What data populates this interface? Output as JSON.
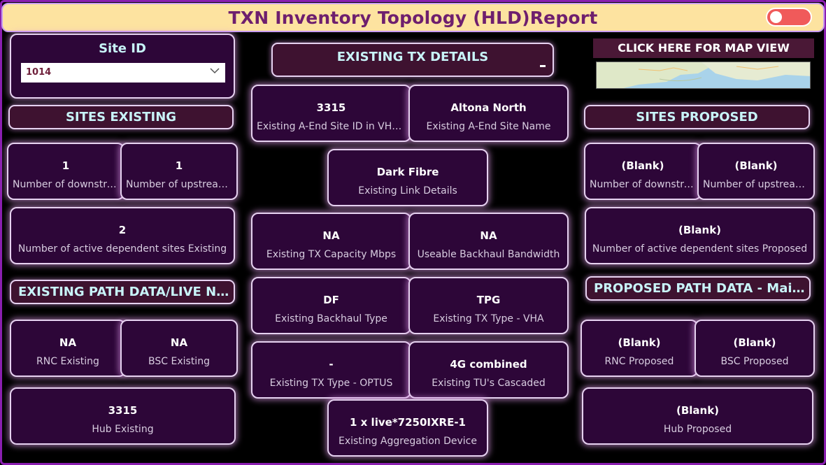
{
  "report": {
    "title": "TXN Inventory Topology (HLD)Report",
    "toggle_state": "off"
  },
  "slicer": {
    "label": "Site ID",
    "selected": "1014"
  },
  "headers": {
    "sites_existing": "SITES EXISTING",
    "existing_tx_details": "EXISTING TX DETAILS",
    "map_view_button": "CLICK HERE FOR MAP VIEW",
    "sites_proposed": "SITES PROPOSED",
    "existing_path": "EXISTING PATH DATA/LIVE NET...",
    "proposed_path": "PROPOSED PATH DATA - Main Ba..."
  },
  "left": {
    "downstream": {
      "value": "1",
      "label": "Number of downstre..."
    },
    "upstream": {
      "value": "1",
      "label": "Number of upstream..."
    },
    "active_dependent": {
      "value": "2",
      "label": "Number of active dependent sites Existing"
    },
    "rnc": {
      "value": "NA",
      "label": "RNC Existing"
    },
    "bsc": {
      "value": "NA",
      "label": "BSC Existing"
    },
    "hub": {
      "value": "3315",
      "label": "Hub Existing"
    }
  },
  "middle": {
    "a_end_site_id": {
      "value": "3315",
      "label": "Existing A-End Site ID in VHA ..."
    },
    "a_end_site_name": {
      "value": "Altona North",
      "label": "Existing A-End Site Name"
    },
    "link_details": {
      "value": "Dark Fibre",
      "label": "Existing Link Details"
    },
    "tx_capacity": {
      "value": "NA",
      "label": "Existing TX Capacity Mbps"
    },
    "backhaul_bandwidth": {
      "value": "NA",
      "label": "Useable Backhaul Bandwidth"
    },
    "backhaul_type": {
      "value": "DF",
      "label": "Existing Backhaul Type"
    },
    "tx_type_vha": {
      "value": "TPG",
      "label": "Existing TX Type - VHA"
    },
    "tx_type_optus": {
      "value": "-",
      "label": "Existing TX Type - OPTUS"
    },
    "tus_cascaded": {
      "value": "4G combined",
      "label": "Existing TU's Cascaded"
    },
    "aggregation_device": {
      "value": "1 x live*7250IXRE-1",
      "label": "Existing Aggregation Device"
    }
  },
  "right": {
    "downstream": {
      "value": "(Blank)",
      "label": "Number of downstre..."
    },
    "upstream": {
      "value": "(Blank)",
      "label": "Number of upstream..."
    },
    "active_dependent": {
      "value": "(Blank)",
      "label": "Number of active dependent sites Proposed"
    },
    "rnc": {
      "value": "(Blank)",
      "label": "RNC Proposed"
    },
    "bsc": {
      "value": "(Blank)",
      "label": "BSC Proposed"
    },
    "hub": {
      "value": "(Blank)",
      "label": "Hub Proposed"
    }
  },
  "colors": {
    "title_bar": "#fde3a0",
    "title_text": "#6e1f6e",
    "card_bg": "#2d0638",
    "header_text": "#c8f4f8",
    "frame": "#8a1fb0",
    "toggle": "#f05a5a"
  },
  "icons": {
    "toggle": "toggle-switch-icon",
    "dropdown": "chevron-down-icon",
    "map": "map-thumbnail"
  }
}
